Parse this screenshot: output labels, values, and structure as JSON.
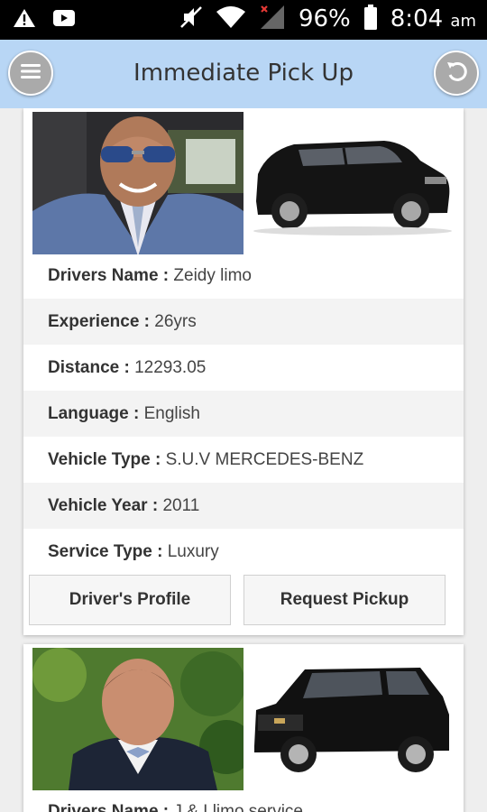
{
  "status_bar": {
    "battery": "96%",
    "time": "8:04",
    "ampm": "am"
  },
  "header": {
    "title": "Immediate Pick Up"
  },
  "drivers": [
    {
      "name_label": "Drivers Name :",
      "name": "Zeidy limo",
      "experience_label": "Experience :",
      "experience": "26yrs",
      "distance_label": "Distance :",
      "distance": "12293.05",
      "language_label": "Language :",
      "language": "English",
      "vehicle_type_label": "Vehicle Type :",
      "vehicle_type": "S.U.V MERCEDES-BENZ",
      "vehicle_year_label": "Vehicle Year :",
      "vehicle_year": "2011",
      "service_type_label": "Service Type :",
      "service_type": "Luxury",
      "profile_button": "Driver's Profile",
      "pickup_button": "Request Pickup"
    },
    {
      "name_label": "Drivers Name :",
      "name": "J & I limo service"
    }
  ],
  "icons": {
    "menu": "menu-icon",
    "back": "back-icon",
    "warning": "warning-icon",
    "youtube": "youtube-icon",
    "mute": "mute-icon",
    "wifi": "wifi-icon",
    "signal": "signal-icon",
    "battery": "battery-icon"
  },
  "colors": {
    "header_bg": "#b8d6f5",
    "status_bg": "#000000"
  }
}
